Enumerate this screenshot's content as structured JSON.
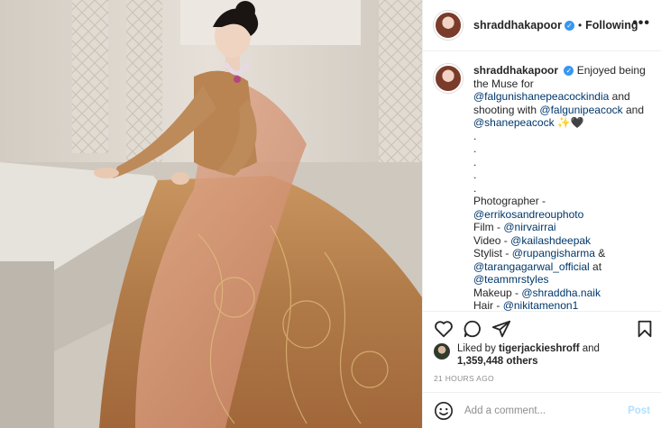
{
  "post": {
    "username": "shraddhakapoor",
    "follow_status": "Following",
    "separator": "•",
    "verified_mark": "✓"
  },
  "caption": {
    "username": "shraddhakapoor",
    "intro": "Enjoyed being the Muse for",
    "mention1": "@falgunishanepeacockindia",
    "mid": "and shooting with",
    "mention2": "@falgunipeacock",
    "and": "and",
    "mention3": "@shanepeacock",
    "emoji": "✨🖤",
    "dot": ".",
    "photographer_label": "Photographer -",
    "photographer": "@errikosandreouphoto",
    "film_label": "Film -",
    "film": "@nirvairrai",
    "video_label": "Video -",
    "video": "@kailashdeepak",
    "stylist_label": "Stylist -",
    "stylist1": "@rupangisharma",
    "amp": "&",
    "stylist2": "@tarangagarwal_official",
    "at": "at",
    "stylist_team": "@teammrstyles",
    "makeup_label": "Makeup -",
    "makeup": "@shraddha.naik",
    "hair_label": "Hair -",
    "hair": "@nikitamenon1"
  },
  "likes": {
    "prefix": "Liked by",
    "user": "tigerjackieshroff",
    "and": "and",
    "count": "1,359,448 others"
  },
  "time": "21 HOURS AGO",
  "comment": {
    "placeholder": "Add a comment...",
    "post_label": "Post"
  },
  "icons": {
    "like": "heart-icon",
    "comment": "comment-icon",
    "share": "share-icon",
    "save": "bookmark-icon",
    "more": "more-icon",
    "emoji": "emoji-icon"
  }
}
